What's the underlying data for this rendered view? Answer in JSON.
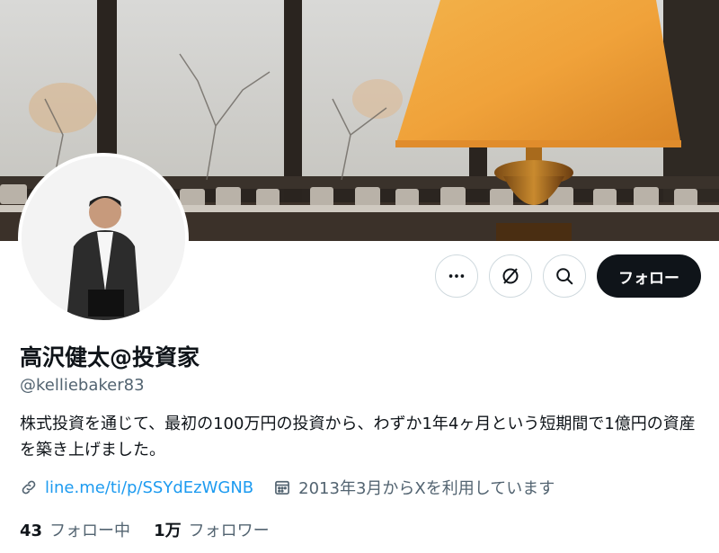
{
  "profile": {
    "display_name": "高沢健太@投資家",
    "handle": "@kelliebaker83",
    "bio": "株式投資を通じて、最初の100万円の投資から、わずか1年4ヶ月という短期間で1億円の資産を築き上げました。",
    "link_text": "line.me/ti/p/SSYdEzWGNB",
    "joined_text": "2013年3月からXを利用しています"
  },
  "actions": {
    "follow_label": "フォロー",
    "more_icon": "more-dots-icon",
    "grok_icon": "grok-icon",
    "search_icon": "search-icon"
  },
  "stats": {
    "following_count": "43",
    "following_label": "フォロー中",
    "followers_count": "1万",
    "followers_label": "フォロワー"
  },
  "colors": {
    "link": "#1d9bf0",
    "secondary_text": "#536471",
    "primary_text": "#0f1419",
    "follow_button": "#0f1419"
  }
}
